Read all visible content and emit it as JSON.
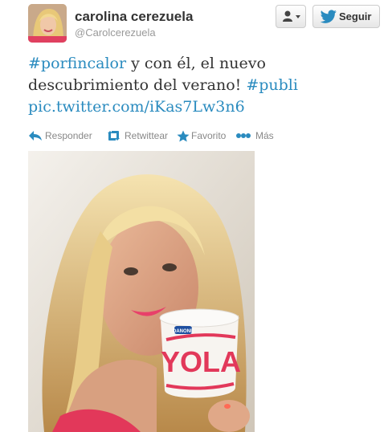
{
  "user": {
    "name": "carolina cerezuela",
    "handle": "@Carolcerezuela"
  },
  "buttons": {
    "follow_label": "Seguir"
  },
  "tweet": {
    "hashtag1": "#porfincalor",
    "text1": " y con él, el nuevo",
    "text2": "descubrimiento del verano! ",
    "hashtag2": "#publi",
    "pic_link": "pic.twitter.com/iKas7Lw3n6"
  },
  "actions": {
    "reply": "Responder",
    "retweet": "Retwittear",
    "favorite": "Favorito",
    "more": "Más"
  },
  "media": {
    "cup_brand": "DANONE",
    "cup_text": "YOLA"
  },
  "colors": {
    "link": "#2a8bbf",
    "action_icon": "#2a8bbf",
    "twitter_bird": "#2a8bbf"
  },
  "icons": {
    "user_menu": "user-dropdown-icon",
    "follow": "twitter-bird-icon",
    "reply": "reply-icon",
    "retweet": "retweet-icon",
    "favorite": "star-icon",
    "more": "more-dots-icon"
  }
}
